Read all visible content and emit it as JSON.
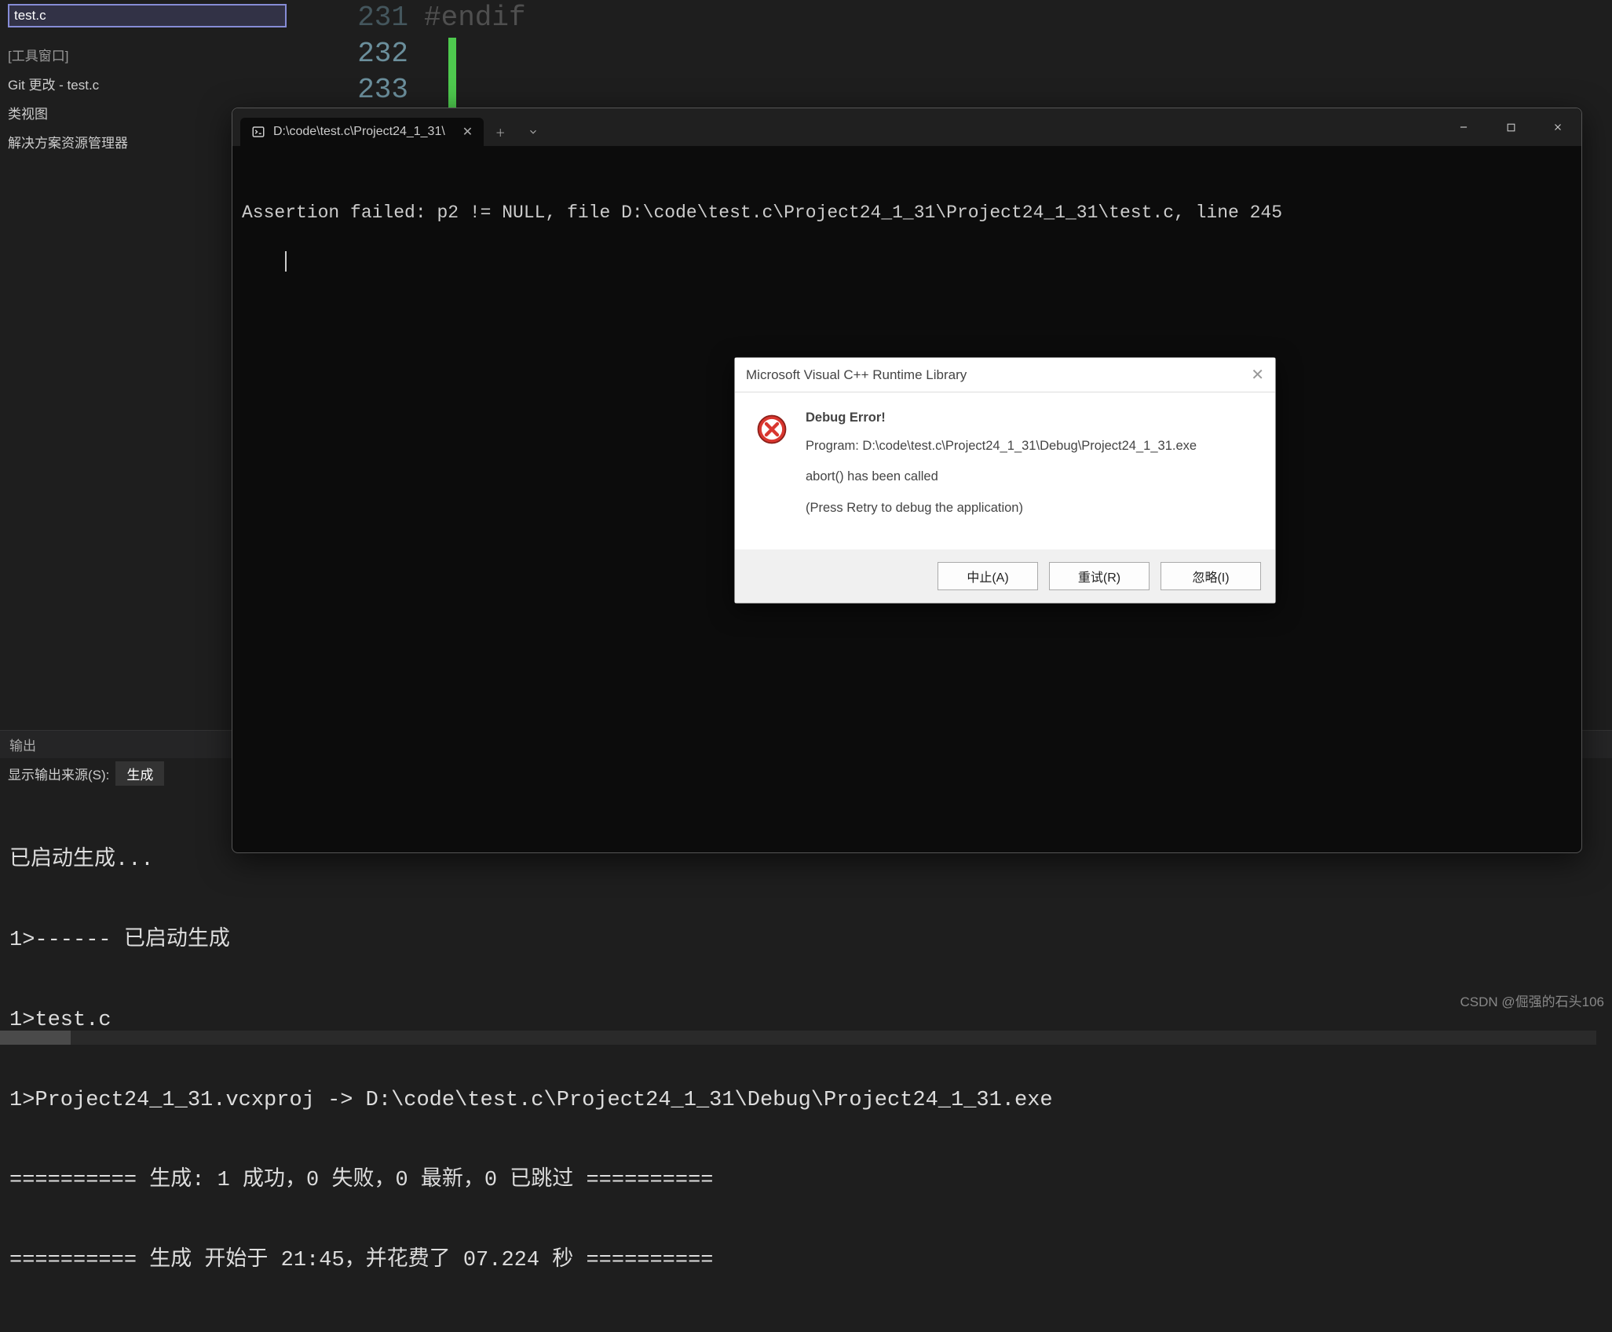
{
  "sidebar": {
    "selected_file": "test.c",
    "tool_window_hdr": "[工具窗口]",
    "items": [
      "Git 更改 - test.c",
      "类视图",
      "解决方案资源管理器"
    ]
  },
  "editor": {
    "line_numbers": [
      "231",
      "232",
      "233"
    ],
    "code_dim": "#endif"
  },
  "terminal": {
    "tab_title": "D:\\code\\test.c\\Project24_1_31\\",
    "assertion_line": "Assertion failed: p2 != NULL, file D:\\code\\test.c\\Project24_1_31\\Project24_1_31\\test.c, line 245"
  },
  "dialog": {
    "title": "Microsoft Visual C++ Runtime Library",
    "header": "Debug Error!",
    "program": "Program: D:\\code\\test.c\\Project24_1_31\\Debug\\Project24_1_31.exe",
    "abort": "abort() has been called",
    "press_retry": "(Press Retry to debug the application)",
    "buttons": {
      "abort": "中止(A)",
      "retry": "重试(R)",
      "ignore": "忽略(I)"
    }
  },
  "output": {
    "panel_title": "输出",
    "source_label": "显示输出来源(S):",
    "source_value": "生成",
    "lines": [
      "已启动生成...",
      "1>------ 已启动生成",
      "1>test.c",
      "1>Project24_1_31.vcxproj -> D:\\code\\test.c\\Project24_1_31\\Debug\\Project24_1_31.exe",
      "========== 生成: 1 成功，0 失败，0 最新，0 已跳过 ==========",
      "========== 生成 开始于 21:45，并花费了 07.224 秒 =========="
    ]
  },
  "watermark": "CSDN @倔强的石头106"
}
